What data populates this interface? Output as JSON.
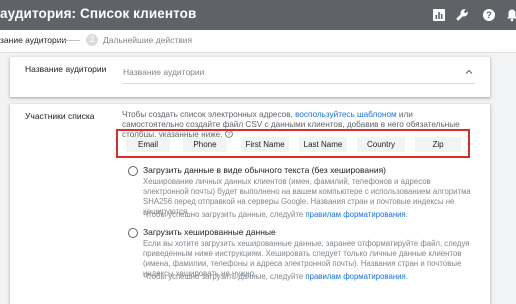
{
  "header": {
    "title": "аудитория: Список клиентов",
    "icons": [
      "chart-icon",
      "wrench-icon",
      "help-icon",
      "bell-icon"
    ]
  },
  "steps": {
    "step1_label": "зание аудитории",
    "step2_number": "2",
    "step2_label": "Дальнейшие действия"
  },
  "audience_name": {
    "label": "Название аудитории",
    "placeholder": "Название аудитории",
    "value": ""
  },
  "members": {
    "label": "Участники списка",
    "desc_before": "Чтобы создать список электронных адресов,",
    "desc_link": "воспользуйтесь шаблоном",
    "desc_after": "или самостоятельно создайте файл CSV с данными клиентов, добавив в него обязательные столбцы, указанные ниже.",
    "columns": [
      "Email",
      "Phone",
      "First Name",
      "Last Name",
      "Country",
      "Zip"
    ]
  },
  "options": [
    {
      "label": "Загрузить данные в виде обычного текста (без хеширования)",
      "desc": "Хеширование личных данных клиентов (имен, фамилий, телефонов и адресов электронной почты) будет выполнено на вашем компьютере с использованием алгоритма SHA256 перед отправкой на серверы Google. Названия стран и почтовые индексы не хешируются.",
      "hint_before": "Чтобы успешно загрузить данные, следуйте",
      "hint_link": "правилам форматирования",
      "hint_after": "."
    },
    {
      "label": "Загрузить хешированные данные",
      "desc": "Если вы хотите загрузить хешированные данные, заранее отформатируйте файл, следуя приведенным ниже инструкциям. Хешировать следует только личные данные клиентов (имена, фамилии, телефоны и адреса электронной почты). Названия стран и почтовые индексы хешировать не нужно.",
      "hint_before": "Чтобы успешно загрузить данные, следуйте",
      "hint_link": "правилам форматирования",
      "hint_after": "."
    }
  ],
  "colors": {
    "topbar": "#5f6368",
    "link": "#1a73e8",
    "highlight": "#d93025"
  }
}
